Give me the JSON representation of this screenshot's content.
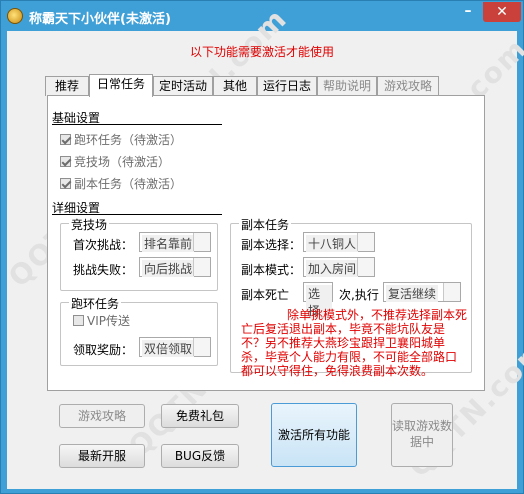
{
  "window": {
    "title": "称霸天下小伙伴(未激活)",
    "min_label": "–",
    "close_label": "✕"
  },
  "notice": "以下功能需要激活才能使用",
  "tabs": [
    "推荐",
    "日常任务",
    "定时活动",
    "其他",
    "运行日志",
    "帮助说明",
    "游戏攻略"
  ],
  "basic": {
    "title": "基础设置",
    "items": [
      "跑环任务（待激活）",
      "竞技场（待激活）",
      "副本任务（待激活）"
    ]
  },
  "detail": {
    "title": "详细设置",
    "arena": {
      "title": "竞技场",
      "first_label": "首次挑战：",
      "first_value": "排名靠前",
      "fail_label": "挑战失败：",
      "fail_value": "向后挑战"
    },
    "loop": {
      "title": "跑环任务",
      "vip_label": "VIP传送",
      "reward_label": "领取奖励：",
      "reward_value": "双倍领取"
    },
    "dungeon": {
      "title": "副本任务",
      "select_label": "副本选择：",
      "select_value": "十八铜人",
      "mode_label": "副本模式：",
      "mode_value": "加入房间",
      "death_label": "副本死亡",
      "death_select_value": "选择",
      "death_mid": "次,执行",
      "death_action_value": "复活继续",
      "note": "除单挑模式外，不推荐选择副本死亡后复活退出副本，毕竟不能坑队友是不？另不推荐大燕珍宝跟捍卫襄阳城单杀，毕竟个人能力有限，不可能全部路口都可以守得住，免得浪费副本次数。"
    }
  },
  "buttons": {
    "guide": "游戏攻略",
    "gift": "免费礼包",
    "activate": "激活所有功能",
    "read": "读取游戏数据中",
    "restart": "最新开服",
    "bug": "BUG反馈"
  },
  "watermark": "QQTN.com"
}
